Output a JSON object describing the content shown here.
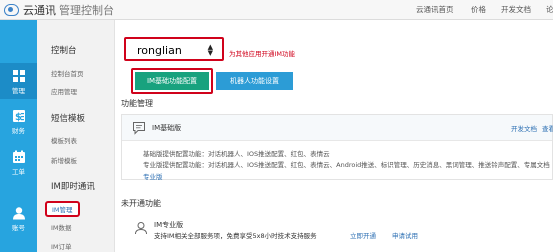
{
  "header": {
    "logo_title": "云通讯",
    "logo_subtitle": "管理控制台",
    "nav": [
      "云通讯首页",
      "价格",
      "开发文档",
      "论"
    ]
  },
  "rail": [
    {
      "label": "管理",
      "icon": "grid-icon",
      "active": true
    },
    {
      "label": "财务",
      "icon": "finance-icon",
      "active": false
    },
    {
      "label": "工单",
      "icon": "calendar-icon",
      "active": false
    },
    {
      "label": "账号",
      "icon": "user-icon",
      "active": false
    }
  ],
  "sidebar": {
    "groups": [
      {
        "title": "控制台",
        "items": [
          "控制台首页",
          "应用管理"
        ]
      },
      {
        "title": "短信模板",
        "items": [
          "模板列表",
          "新增模板"
        ]
      },
      {
        "title": "IM即时通讯",
        "items": [
          "IM管理",
          "IM数据",
          "IM订单"
        ]
      }
    ],
    "active_item": "IM管理"
  },
  "main": {
    "app_select": {
      "value": "ronglian"
    },
    "hint": "为其他应用开通IM功能",
    "tabs": [
      {
        "label": "IM基础功能配置",
        "active": true
      },
      {
        "label": "机器人功能设置",
        "active": false
      }
    ],
    "function_title": "功能管理",
    "basic": {
      "name": "IM基础版",
      "doc_link": "开发文档",
      "more_link": "查看",
      "line1": "基础版提供配置功能：对话机器人、IOS推送配置、红包、表情云",
      "line2": "专业版提供配置功能：对话机器人、IOS推送配置、红包、表情云、Android推送、标识管理、历史消息、黑词管理、推送铃声配置、专属文档",
      "link": "专业版"
    },
    "unopened_title": "未开通功能",
    "pro": {
      "name": "IM专业版",
      "desc": "支持IM相关全部服务项，免费享受5x8小时技术支持服务",
      "links": [
        "立即开通",
        "申请试用"
      ]
    }
  },
  "colors": {
    "rail": "#27a4df",
    "tab_active": "#18a27e",
    "tab_inactive": "#2c9cd6",
    "highlight": "#d0021b",
    "link": "#2c6fb3"
  }
}
